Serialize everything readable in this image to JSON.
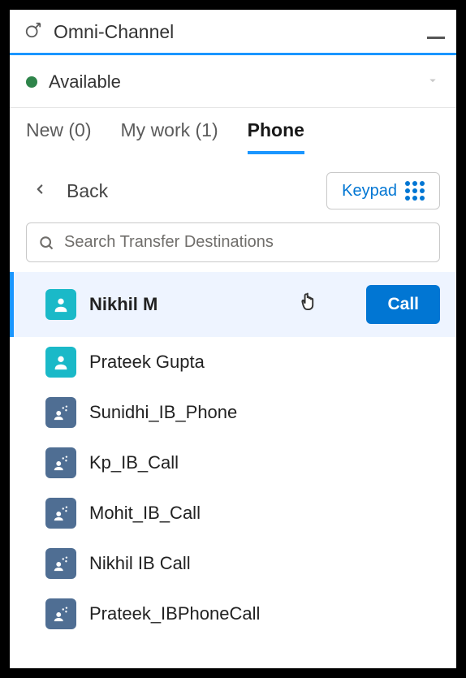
{
  "header": {
    "title": "Omni-Channel"
  },
  "status": {
    "text": "Available",
    "color": "#2e844a"
  },
  "tabs": [
    {
      "id": "new",
      "label": "New (0)",
      "active": false
    },
    {
      "id": "mywork",
      "label": "My work (1)",
      "active": false
    },
    {
      "id": "phone",
      "label": "Phone",
      "active": true
    }
  ],
  "nav": {
    "back": "Back",
    "keypad": "Keypad"
  },
  "search": {
    "placeholder": "Search Transfer Destinations"
  },
  "actions": {
    "call": "Call"
  },
  "destinations": [
    {
      "name": "Nikhil M",
      "type": "user",
      "selected": true
    },
    {
      "name": "Prateek Gupta",
      "type": "user",
      "selected": false
    },
    {
      "name": "Sunidhi_IB_Phone",
      "type": "queue",
      "selected": false
    },
    {
      "name": "Kp_IB_Call",
      "type": "queue",
      "selected": false
    },
    {
      "name": "Mohit_IB_Call",
      "type": "queue",
      "selected": false
    },
    {
      "name": "Nikhil IB Call",
      "type": "queue",
      "selected": false
    },
    {
      "name": "Prateek_IBPhoneCall",
      "type": "queue",
      "selected": false
    }
  ]
}
